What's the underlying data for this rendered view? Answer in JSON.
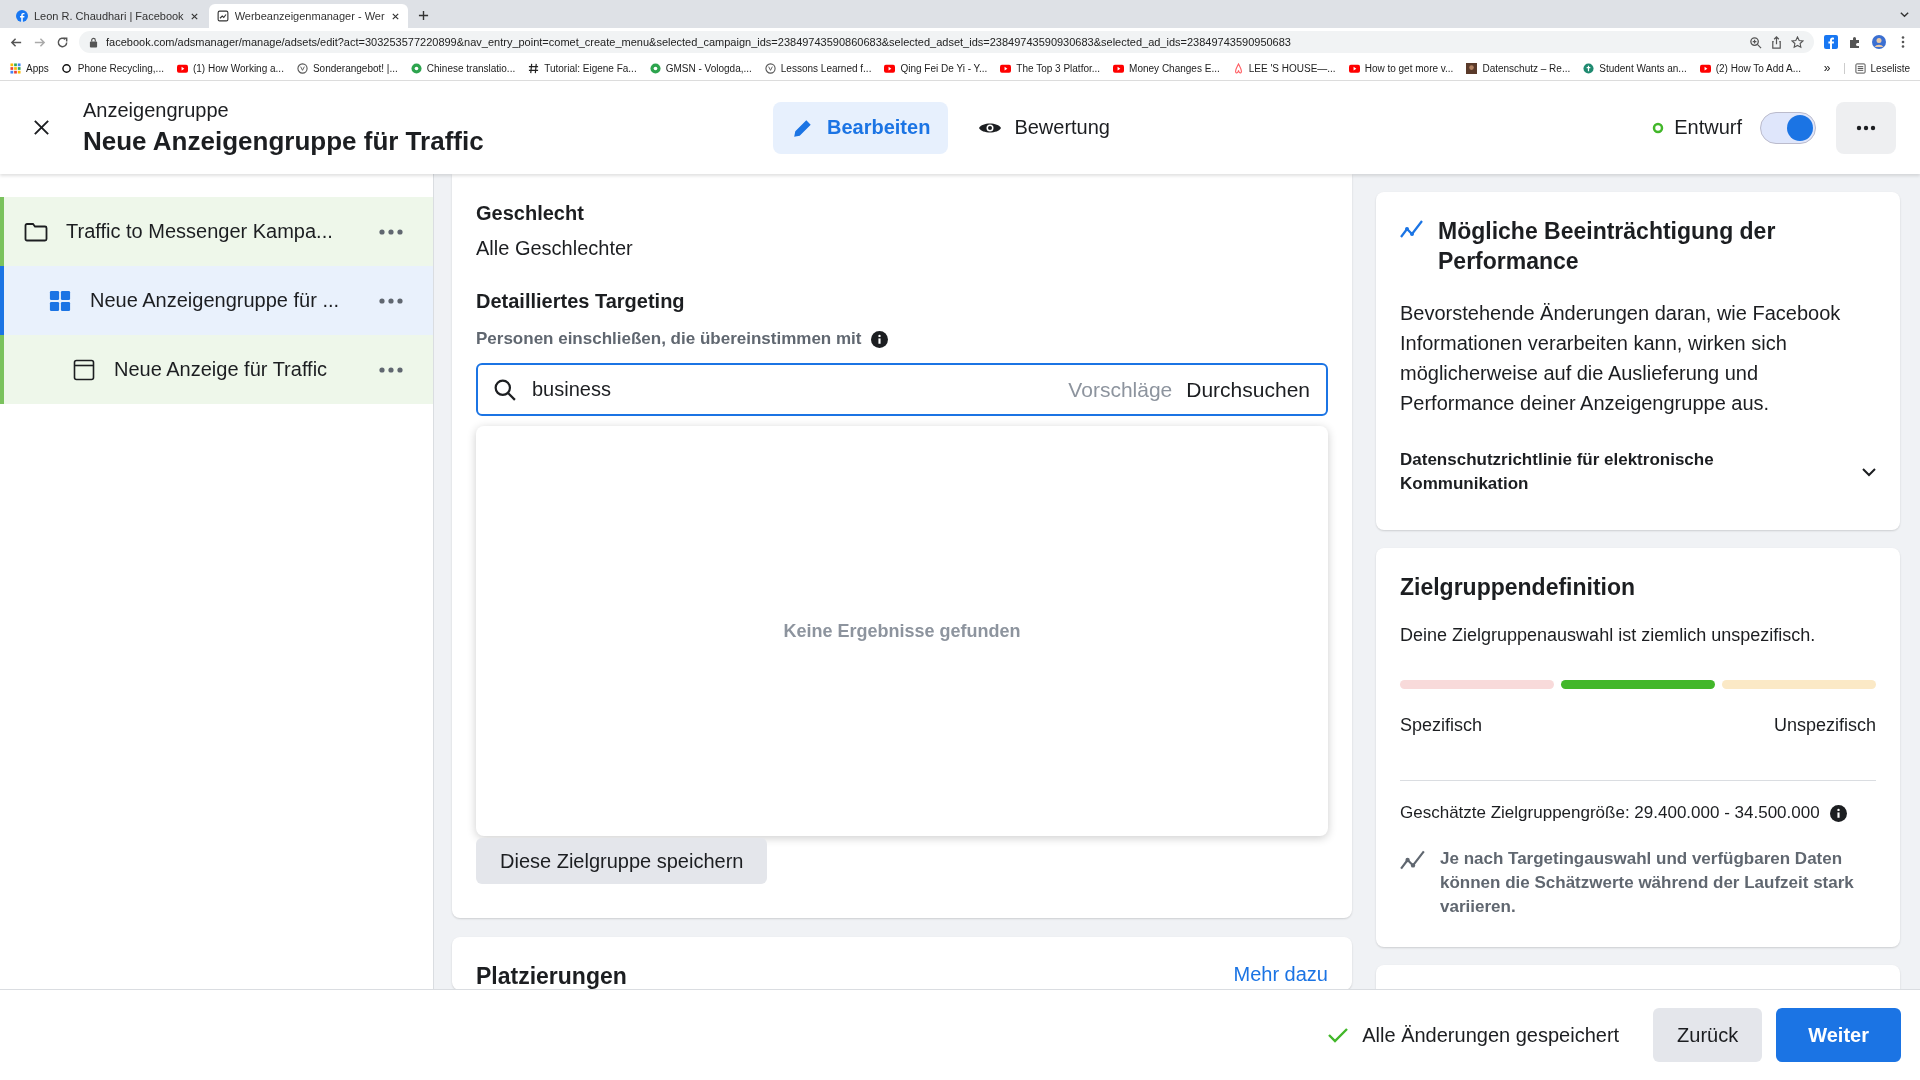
{
  "browser": {
    "tabs": [
      {
        "title": "Leon R. Chaudhari | Facebook",
        "kind": "facebook",
        "selected": false
      },
      {
        "title": "Werbeanzeigenmanager - Wer",
        "kind": "ads",
        "selected": true
      }
    ],
    "url": "facebook.com/adsmanager/manage/adsets/edit?act=303253577220899&nav_entry_point=comet_create_menu&selected_campaign_ids=23849743590860683&selected_adset_ids=23849743590930683&selected_ad_ids=23849743590950683",
    "bookmarks": [
      {
        "label": "Apps",
        "kind": "grid"
      },
      {
        "label": "Phone Recycling,...",
        "kind": "o2"
      },
      {
        "label": "(1) How Working a...",
        "kind": "video"
      },
      {
        "label": "Sonderangebot! |...",
        "kind": "round"
      },
      {
        "label": "Chinese translatio...",
        "kind": "green"
      },
      {
        "label": "Tutorial: Eigene Fa...",
        "kind": "hash"
      },
      {
        "label": "GMSN - Vologda,...",
        "kind": "green"
      },
      {
        "label": "Lessons Learned f...",
        "kind": "round"
      },
      {
        "label": "Qing Fei De Yi - Y...",
        "kind": "video"
      },
      {
        "label": "The Top 3 Platfor...",
        "kind": "video"
      },
      {
        "label": "Money Changes E...",
        "kind": "video"
      },
      {
        "label": "LEE 'S HOUSE—...",
        "kind": "airbnb"
      },
      {
        "label": "How to get more v...",
        "kind": "video"
      },
      {
        "label": "Datenschutz – Re...",
        "kind": "photo"
      },
      {
        "label": "Student Wants an...",
        "kind": "teal"
      },
      {
        "label": "(2) How To Add A...",
        "kind": "video"
      }
    ],
    "more": "»",
    "reading_list": "Leseliste"
  },
  "header": {
    "subtitle": "Anzeigengruppe",
    "title": "Neue Anzeigengruppe für Traffic",
    "tabs": [
      {
        "label": "Bearbeiten",
        "kind": "edit",
        "selected": true
      },
      {
        "label": "Bewertung",
        "kind": "review",
        "selected": false
      }
    ],
    "status": "Entwurf",
    "toggle_on": true
  },
  "sidebar": {
    "items": [
      {
        "label": "Traffic to Messenger Kampa...",
        "kind": "campaign",
        "selected": false,
        "children": [
          {
            "label": "Neue Anzeigengruppe für ...",
            "kind": "adset",
            "selected": true,
            "children": [
              {
                "label": "Neue Anzeige für Traffic",
                "kind": "ad",
                "selected": false
              }
            ]
          }
        ]
      }
    ]
  },
  "audience": {
    "gender_label": "Geschlecht",
    "gender_value": "Alle Geschlechter",
    "targeting_title": "Detailliertes Targeting",
    "targeting_hint": "Personen einschließen, die übereinstimmen mit",
    "search": {
      "value": "business",
      "suggestions": "Vorschläge",
      "browse": "Durchsuchen"
    },
    "dropdown_message": "Keine Ergebnisse gefunden",
    "save_button": "Diese Zielgruppe speichern"
  },
  "placements": {
    "title": "Platzierungen",
    "link": "Mehr dazu"
  },
  "performance": {
    "title": "Mögliche Beeinträchtigung der Performance",
    "text": "Bevorstehende Änderungen daran, wie Facebook Informationen verarbeiten kann, wirken sich möglicherweise auf die Auslieferung und Performance deiner Anzeigengruppe aus.",
    "accordion": {
      "label": "Datenschutzrichtlinie für elektronische Kommunikation",
      "expanded": false
    }
  },
  "definition": {
    "title": "Zielgruppendefinition",
    "text": "Deine Zielgruppenauswahl ist ziemlich unspezifisch.",
    "segments": [
      {
        "kind": "narrow",
        "selected": false
      },
      {
        "kind": "fit",
        "selected": true
      },
      {
        "kind": "broad",
        "selected": false
      }
    ],
    "left_label": "Spezifisch",
    "right_label": "Unspezifisch",
    "size": "Geschätzte Zielgruppengröße: 29.400.000 - 34.500.000",
    "note": "Je nach Targetingauswahl und verfügbaren Daten können die Schätzwerte während der Laufzeit stark variieren."
  },
  "footer": {
    "saved": "Alle Änderungen gespeichert",
    "back": "Zurück",
    "next": "Weiter"
  }
}
